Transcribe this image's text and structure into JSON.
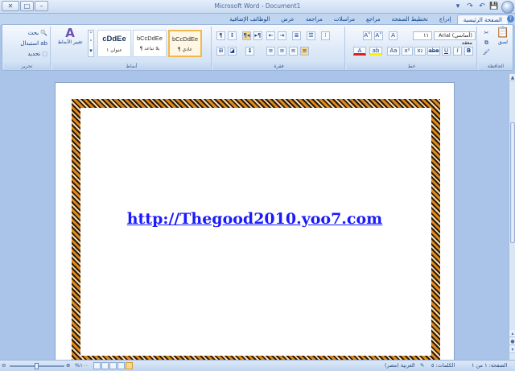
{
  "window": {
    "title": "Microsoft Word - Document1",
    "minimize": "–",
    "maximize": "□",
    "close": "✕"
  },
  "quick_access": {
    "save": "💾",
    "undo": "↶",
    "redo": "↷",
    "more": "▾"
  },
  "tabs": [
    {
      "label": "الصفحة الرئيسية",
      "active": true
    },
    {
      "label": "إدراج"
    },
    {
      "label": "تخطيط الصفحة"
    },
    {
      "label": "مراجع"
    },
    {
      "label": "مراسلات"
    },
    {
      "label": "مراجعة"
    },
    {
      "label": "عرض"
    },
    {
      "label": "الوظائف الإضافية"
    }
  ],
  "ribbon": {
    "clipboard": {
      "label": "الحافظة",
      "paste": "لصق"
    },
    "font": {
      "label": "خط",
      "font_name": "Arial (أساسي) معقد",
      "font_size": "١١",
      "grow": "A˄",
      "shrink": "A˅",
      "clear": "A",
      "bold": "B",
      "italic": "I",
      "underline": "U",
      "strike": "abe",
      "subscript": "x₂",
      "superscript": "x²",
      "case": "Aa",
      "highlight": "ab",
      "font_color": "A"
    },
    "paragraph": {
      "label": "فقرة"
    },
    "styles": {
      "label": "أنماط",
      "items": [
        {
          "sample": "bCcDdEe",
          "name": "¶ عادي",
          "selected": true
        },
        {
          "sample": "bCcDdEe",
          "name": "¶ بلا تباعد"
        },
        {
          "sample": "cDdEe",
          "name": "عنوان ١"
        }
      ],
      "change_styles": "تغيير الأنماط"
    },
    "editing": {
      "label": "تحرير",
      "find": "بحث",
      "replace": "استبدال",
      "select": "تحديد"
    }
  },
  "document": {
    "link_text": "http://Thegood2010.yoo7.com"
  },
  "status": {
    "page": "الصفحة: ١ من ١",
    "words": "الكلمات: ٥",
    "language": "العربية (مصر)",
    "zoom": "%١٠٠",
    "zoom_level": 1.0
  }
}
